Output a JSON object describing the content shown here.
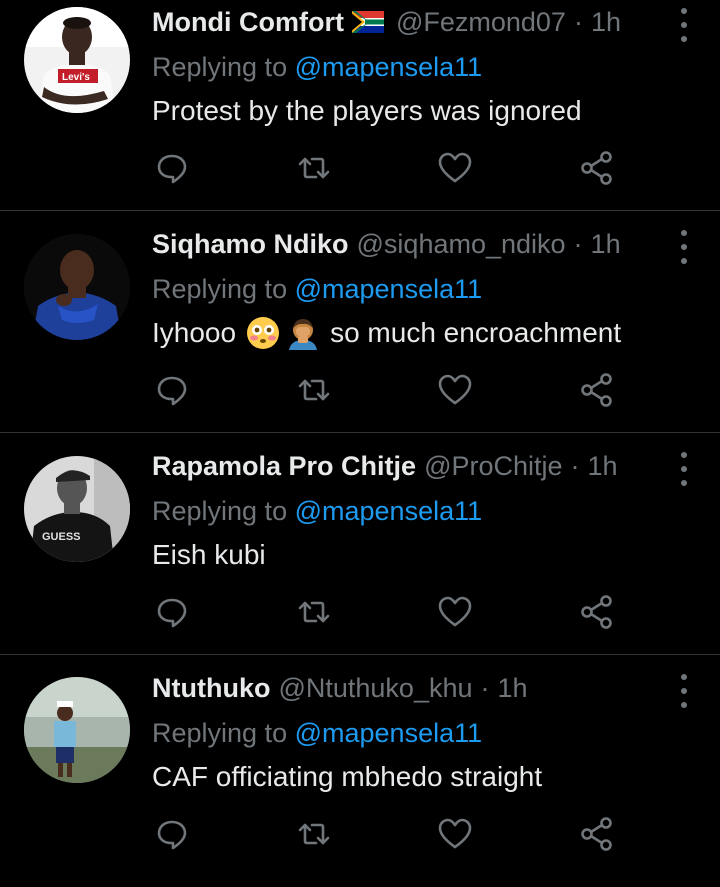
{
  "colors": {
    "background": "#000000",
    "primary_text": "#e7e9ea",
    "secondary_text": "#71767b",
    "link_blue": "#1d9bf0",
    "divider": "#2f3336"
  },
  "tweets": [
    {
      "display_name": "Mondi Comfort",
      "name_emoji": "south-africa-flag",
      "handle": "@Fezmond07",
      "separator": "·",
      "time": "1h",
      "replying_prefix": "Replying to",
      "replying_to": "@mapensela11",
      "text": "Protest by the players was ignored"
    },
    {
      "display_name": "Siqhamo Ndiko",
      "handle": "@siqhamo_ndiko",
      "separator": "·",
      "time": "1h",
      "replying_prefix": "Replying to",
      "replying_to": "@mapensela11",
      "text_before": "Iyhooo",
      "emojis": [
        "flushed-face-emoji",
        "person-facepalming-emoji"
      ],
      "text_after": "so much encroachment"
    },
    {
      "display_name": "Rapamola Pro Chitje",
      "handle": "@ProChitje",
      "separator": "·",
      "time": "1h",
      "replying_prefix": "Replying to",
      "replying_to": "@mapensela11",
      "text": "Eish kubi"
    },
    {
      "display_name": "Ntuthuko",
      "handle": "@Ntuthuko_khu",
      "separator": "·",
      "time": "1h",
      "replying_prefix": "Replying to",
      "replying_to": "@mapensela11",
      "text": "CAF officiating mbhedo straight"
    }
  ],
  "action_icons": [
    "reply-icon",
    "retweet-icon",
    "like-icon",
    "share-icon"
  ]
}
